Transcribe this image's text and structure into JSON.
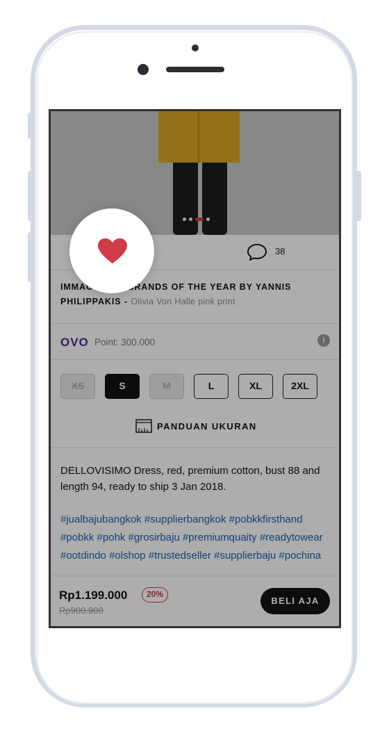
{
  "hero": {
    "carousel_dots": 4,
    "active_dot": 2
  },
  "actions": {
    "comment_count": "38"
  },
  "product": {
    "title": "IMMACULATE BRANDS OF THE YEAR BY YANNIS PHILIPPAKIS -",
    "subtitle": "Olivia Von Halle pink print"
  },
  "ovo": {
    "logo": "OVO",
    "points": "Point: 300.000",
    "info_glyph": "i"
  },
  "sizes": [
    {
      "label": "XS",
      "state": "disabled"
    },
    {
      "label": "S",
      "state": "selected"
    },
    {
      "label": "M",
      "state": "disabled"
    },
    {
      "label": "L",
      "state": "available"
    },
    {
      "label": "XL",
      "state": "available"
    },
    {
      "label": "2XL",
      "state": "available"
    }
  ],
  "size_guide": {
    "label": "PANDUAN UKURAN"
  },
  "description": "DELLOVISIMO Dress, red, premium cotton, bust 88 and length 94, ready to ship 3 Jan 2018.",
  "hashtags": "#jualbajubangkok #supplierbangkok #pobkkfirsthand #pobkk #pohk #grosirbaju #premiumquaity #readytowear #ootdindo #olshop #trustedseller #supplierbaju #pochina",
  "footer": {
    "price": "Rp1.199.000",
    "discount": "20%",
    "old_price": "Rp900.900",
    "buy_label": "BELI AJA"
  },
  "colors": {
    "accent_red": "#d13a47",
    "ovo_purple": "#4b2a91",
    "hashtag_blue": "#1f5fae",
    "coat_yellow": "#d7a725",
    "phone_frame": "#d3d9e6"
  }
}
